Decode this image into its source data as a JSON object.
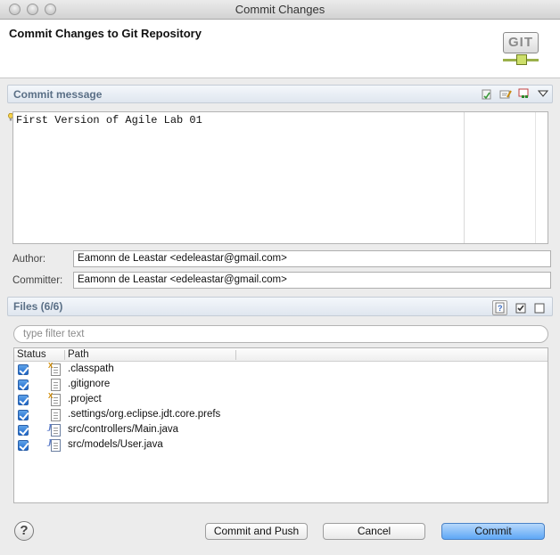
{
  "window": {
    "title": "Commit Changes"
  },
  "banner": {
    "title": "Commit Changes to Git Repository",
    "logo_text": "GIT"
  },
  "commit_message": {
    "section_label": "Commit message",
    "text": "First Version of Agile Lab 01"
  },
  "author": {
    "label": "Author:",
    "value": "Eamonn de Leastar <edeleastar@gmail.com>"
  },
  "committer": {
    "label": "Committer:",
    "value": "Eamonn de Leastar <edeleastar@gmail.com>"
  },
  "files": {
    "section_label": "Files (6/6)",
    "filter_placeholder": "type filter text",
    "columns": [
      "Status",
      "Path"
    ],
    "rows": [
      {
        "path": ".classpath",
        "checked": true,
        "icon": "xml-file-icon"
      },
      {
        "path": ".gitignore",
        "checked": true,
        "icon": "text-file-icon"
      },
      {
        "path": ".project",
        "checked": true,
        "icon": "xml-file-icon"
      },
      {
        "path": ".settings/org.eclipse.jdt.core.prefs",
        "checked": true,
        "icon": "text-file-icon"
      },
      {
        "path": "src/controllers/Main.java",
        "checked": true,
        "icon": "java-file-icon"
      },
      {
        "path": "src/models/User.java",
        "checked": true,
        "icon": "java-file-icon"
      }
    ]
  },
  "buttons": {
    "commit_and_push": "Commit and Push",
    "cancel": "Cancel",
    "commit": "Commit",
    "help": "?"
  },
  "colors": {
    "section_label": "#5a6f86",
    "primary_button": "#5ea7f6"
  }
}
